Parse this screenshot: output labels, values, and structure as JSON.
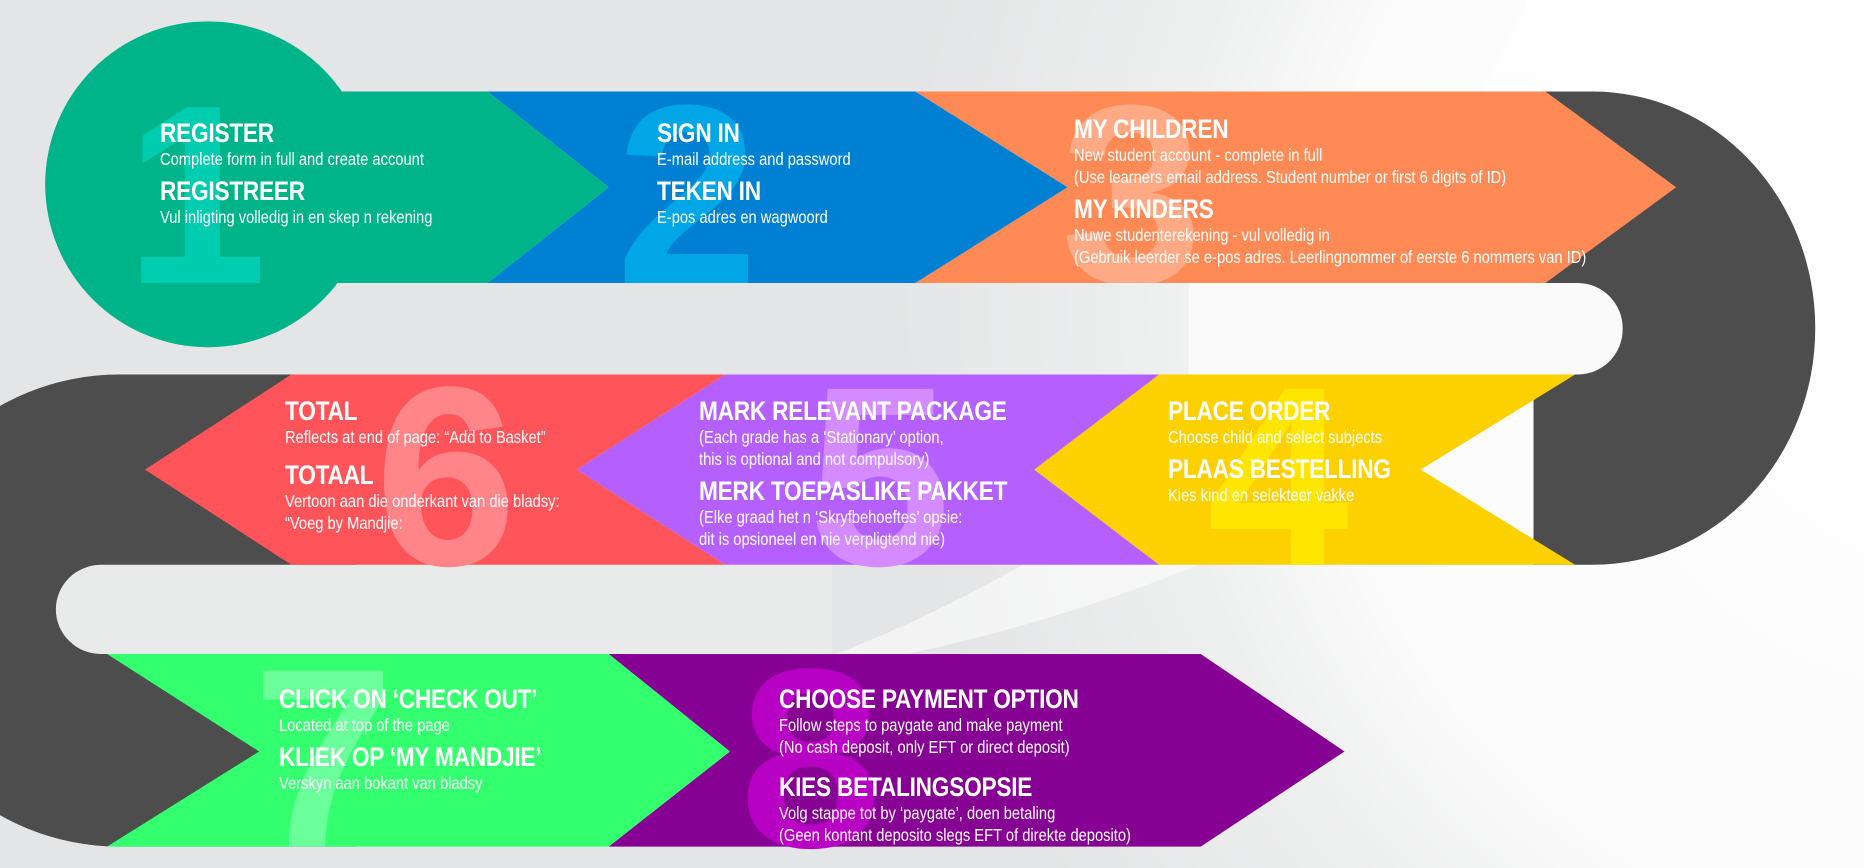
{
  "colors": {
    "background": "#e6e7e8",
    "track": "#4d4d4d",
    "step1": "#00b48a",
    "step2": "#0080d2",
    "step3": "#ff8a55",
    "step4": "#fdd000",
    "step5": "#b65fff",
    "step6": "#ff5459",
    "step7": "#33ff6f",
    "step8": "#850093"
  },
  "steps": [
    {
      "number": "1",
      "groups": [
        {
          "title": "REGISTER",
          "lines": [
            "Complete form in full and create account"
          ]
        },
        {
          "title": "REGISTREER",
          "lines": [
            "Vul inligting volledig in en skep n rekening"
          ]
        }
      ]
    },
    {
      "number": "2",
      "groups": [
        {
          "title": "SIGN IN",
          "lines": [
            "E-mail address and password"
          ]
        },
        {
          "title": "TEKEN IN",
          "lines": [
            "E-pos adres en wagwoord"
          ]
        }
      ]
    },
    {
      "number": "3",
      "groups": [
        {
          "title": "MY CHILDREN",
          "lines": [
            "New student account - complete in full",
            "(Use learners email address. Student number or first 6 digits  of ID)"
          ]
        },
        {
          "title": "MY KINDERS",
          "lines": [
            "Nuwe studenterekening - vul volledig in",
            "(Gebruik leerder se e-pos adres. Leerlingnommer of eerste 6 nommers van ID)"
          ]
        }
      ]
    },
    {
      "number": "4",
      "groups": [
        {
          "title": "PLACE ORDER",
          "lines": [
            "Choose child and select subjects"
          ]
        },
        {
          "title": "PLAAS BESTELLING",
          "lines": [
            "Kies kind en selekteer vakke"
          ]
        }
      ]
    },
    {
      "number": "5",
      "groups": [
        {
          "title": "MARK RELEVANT PACKAGE",
          "lines": [
            "(Each grade has a ‘Stationary’ option,",
            "this is optional and not compulsory)"
          ]
        },
        {
          "title": "MERK TOEPASLIKE PAKKET",
          "lines": [
            "(Elke graad het n ‘Skryfbehoeftes’ opsie:",
            "dit is opsioneel en nie verpligtend nie)"
          ]
        }
      ]
    },
    {
      "number": "6",
      "groups": [
        {
          "title": "TOTAL",
          "lines": [
            "Reflects at end of page: “Add to Basket”"
          ]
        },
        {
          "title": "TOTAAL",
          "lines": [
            "Vertoon aan die onderkant van die bladsy:",
            "“Voeg by Mandjie:"
          ]
        }
      ]
    },
    {
      "number": "7",
      "groups": [
        {
          "title": "CLICK ON ‘CHECK OUT’",
          "lines": [
            "Located at top of the page"
          ]
        },
        {
          "title": "KLIEK OP ‘MY MANDJIE’",
          "lines": [
            "Verskyn aan bokant van bladsy"
          ]
        }
      ]
    },
    {
      "number": "8",
      "groups": [
        {
          "title": "CHOOSE PAYMENT OPTION",
          "lines": [
            "Follow steps to paygate and make payment",
            "(No cash deposit, only EFT or direct deposit)"
          ]
        },
        {
          "title": "KIES BETALINGSOPSIE",
          "lines": [
            "Volg stappe tot by ‘paygate’, doen betaling",
            "(Geen kontant deposito slegs EFT of direkte deposito)"
          ]
        }
      ]
    }
  ]
}
